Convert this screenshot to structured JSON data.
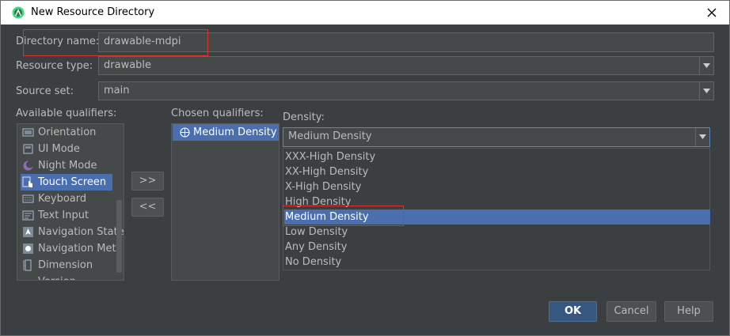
{
  "window": {
    "title": "New Resource Directory"
  },
  "form": {
    "directory_name_label": "Directory name:",
    "directory_name_value": "drawable-mdpi",
    "resource_type_label": "Resource type:",
    "resource_type_value": "drawable",
    "source_set_label": "Source set:",
    "source_set_value": "main"
  },
  "available": {
    "label": "Available qualifiers:",
    "items": [
      {
        "label": "Orientation",
        "icon": "orientation-icon"
      },
      {
        "label": "UI Mode",
        "icon": "ui-mode-icon"
      },
      {
        "label": "Night Mode",
        "icon": "night-mode-icon"
      },
      {
        "label": "Touch Screen",
        "icon": "touch-screen-icon"
      },
      {
        "label": "Keyboard",
        "icon": "keyboard-icon"
      },
      {
        "label": "Text Input",
        "icon": "text-input-icon"
      },
      {
        "label": "Navigation State",
        "icon": "navigation-state-icon"
      },
      {
        "label": "Navigation Meth",
        "icon": "navigation-method-icon"
      },
      {
        "label": "Dimension",
        "icon": "dimension-icon"
      },
      {
        "label": "Version",
        "icon": "version-icon"
      }
    ]
  },
  "move": {
    "add_label": ">>",
    "remove_label": "<<"
  },
  "chosen": {
    "label": "Chosen qualifiers:",
    "items": [
      {
        "label": "Medium Density",
        "icon": "density-icon"
      }
    ]
  },
  "density": {
    "label": "Density:",
    "selected": "Medium Density",
    "options": [
      "XXX-High Density",
      "XX-High Density",
      "X-High Density",
      "High Density",
      "Medium Density",
      "Low Density",
      "Any Density",
      "No Density"
    ]
  },
  "buttons": {
    "ok": "OK",
    "cancel": "Cancel",
    "help": "Help"
  },
  "colors": {
    "background": "#3c3f41",
    "selection": "#4b6eaf",
    "ok_button": "#365880",
    "highlight_border": "#e03030"
  }
}
